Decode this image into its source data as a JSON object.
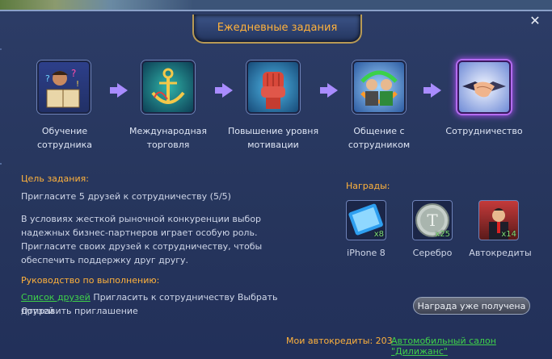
{
  "window": {
    "title": "Ежедневные задания",
    "close_icon": "close-icon"
  },
  "steps": [
    {
      "label": "Обучение сотрудника",
      "icon": "training-icon"
    },
    {
      "label": "Международная торговля",
      "icon": "anchor-icon"
    },
    {
      "label": "Повышение уровня мотивации",
      "icon": "fist-icon"
    },
    {
      "label": "Общение с сотрудником",
      "icon": "communication-icon"
    },
    {
      "label": "Сотрудничество",
      "icon": "handshake-icon",
      "active": true
    }
  ],
  "task": {
    "goal_heading": "Цель задания:",
    "goal_text": "Пригласите 5 друзей к сотрудничеству (5/5)",
    "description": "В условиях жесткой рыночной конкуренции выбор надежных бизнес-партнеров играет особую роль. Пригласите своих друзей к сотрудничеству, чтобы обеспечить поддержку друг другу.",
    "guide_heading": "Руководство по выполнению:",
    "guide_link": "Список друзей",
    "guide_text_1": "Пригласить к сотрудничеству",
    "guide_text_2": "Выбрать друзей",
    "guide_text_3": "Отправить приглашение"
  },
  "rewards": {
    "heading": "Награды:",
    "items": [
      {
        "label": "iPhone 8",
        "count": "x8",
        "icon": "phone-icon"
      },
      {
        "label": "Серебро",
        "count": "x25",
        "icon": "silver-coin-icon"
      },
      {
        "label": "Автокредиты",
        "count": "x14",
        "icon": "autocredit-icon"
      }
    ],
    "button": "Награда уже получена"
  },
  "footer": {
    "credits_label": "Мои автокредиты: 203",
    "salon_link": "Автомобильный салон \"Дилижанс\""
  },
  "colors": {
    "accent": "#ffb23c",
    "link": "#3fd14a",
    "active_glow": "#b46cf0"
  }
}
